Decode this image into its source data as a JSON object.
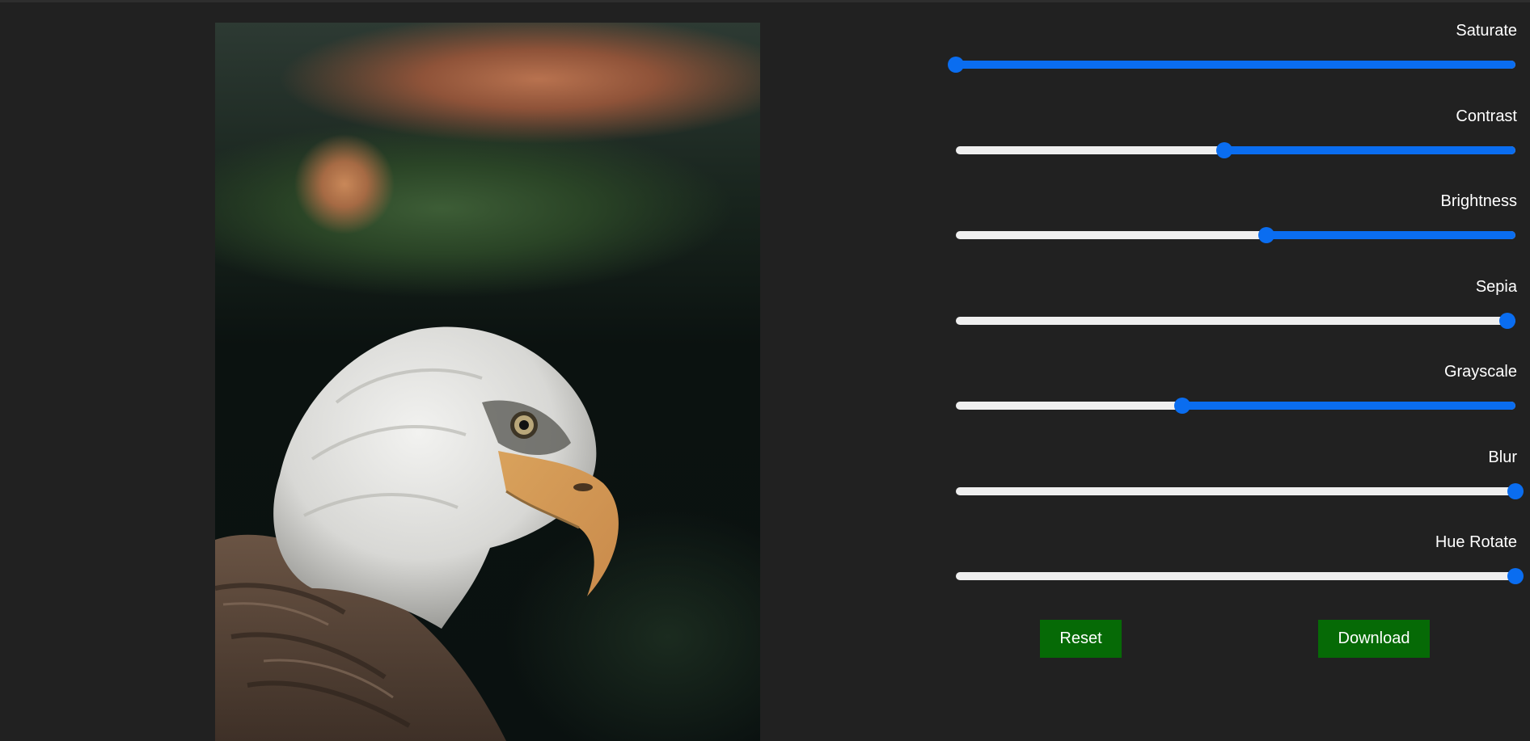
{
  "sliders": [
    {
      "label": "Saturate",
      "value_fraction": 0.0
    },
    {
      "label": "Contrast",
      "value_fraction": 0.48
    },
    {
      "label": "Brightness",
      "value_fraction": 0.555
    },
    {
      "label": "Sepia",
      "value_fraction": 0.985
    },
    {
      "label": "Grayscale",
      "value_fraction": 0.405
    },
    {
      "label": "Blur",
      "value_fraction": 1.0
    },
    {
      "label": "Hue Rotate",
      "value_fraction": 1.0
    }
  ],
  "buttons": {
    "reset_label": "Reset",
    "download_label": "Download"
  },
  "colors": {
    "background": "#212121",
    "accent": "#0a6df0",
    "button": "#066a06",
    "track": "#efefef"
  },
  "image": {
    "subject": "bald-eagle-photo"
  }
}
